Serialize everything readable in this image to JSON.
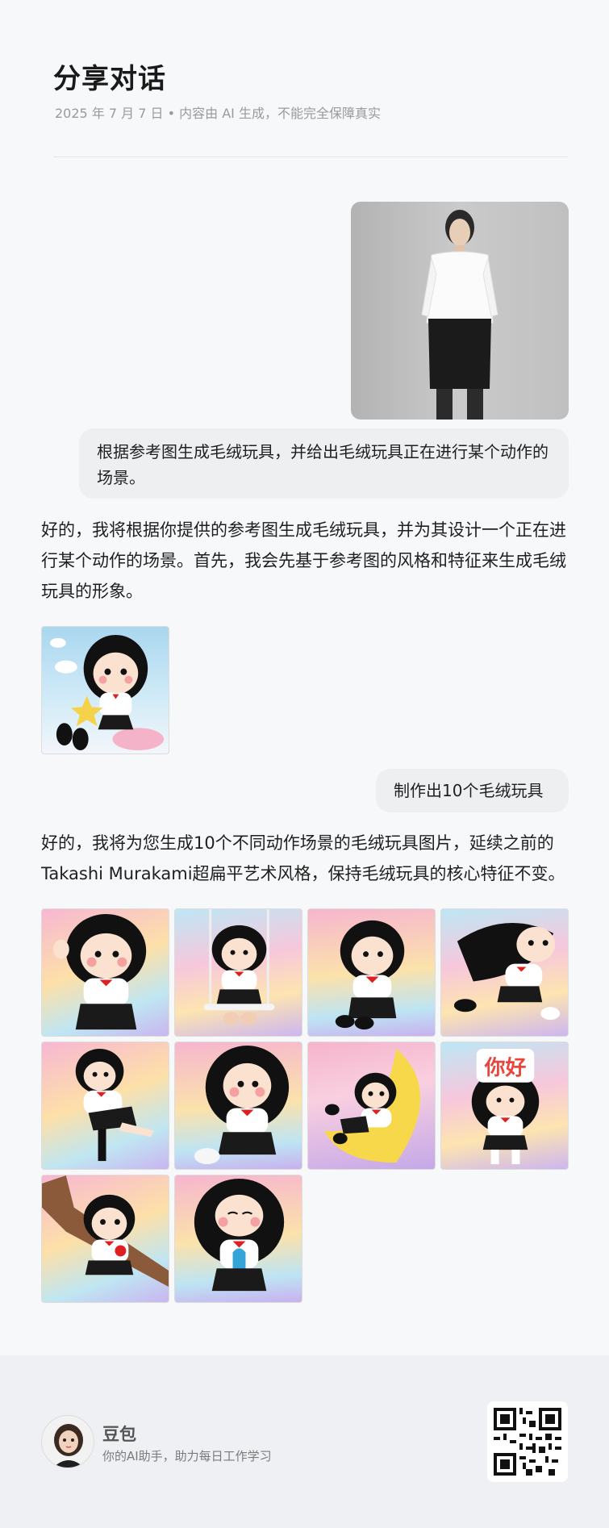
{
  "header": {
    "title": "分享对话",
    "meta": "2025 年 7 月 7 日 • 内容由 AI 生成，不能完全保障真实"
  },
  "conversation": {
    "user_message_1": "根据参考图生成毛绒玩具，并给出毛绒玩具正在进行某个动作的场景。",
    "assistant_reply_1": "好的，我将根据你提供的参考图生成毛绒玩具，并为其设计一个正在进行某个动作的场景。首先，我会先基于参考图的风格和特征来生成毛绒玩具的形象。",
    "user_message_2": "制作出10个毛绒玩具",
    "assistant_reply_2": "好的，我将为您生成10个不同动作场景的毛绒玩具图片，延续之前的Takashi Murakami超扁平艺术风格，保持毛绒玩具的核心特征不变。",
    "hello_sign_text": "你好",
    "gallery_count": 10
  },
  "footer": {
    "brand_name": "豆包",
    "brand_tagline": "你的AI助手，助力每日工作学习",
    "avatar_icon": "girl-avatar-icon",
    "qr_icon": "qr-code-icon"
  },
  "colors": {
    "page_bg": "#f7f8fa",
    "bubble_bg": "#eeeff1",
    "footer_bg": "#eff0f3",
    "plush_hair": "#111111",
    "plush_bow": "#e02020"
  }
}
